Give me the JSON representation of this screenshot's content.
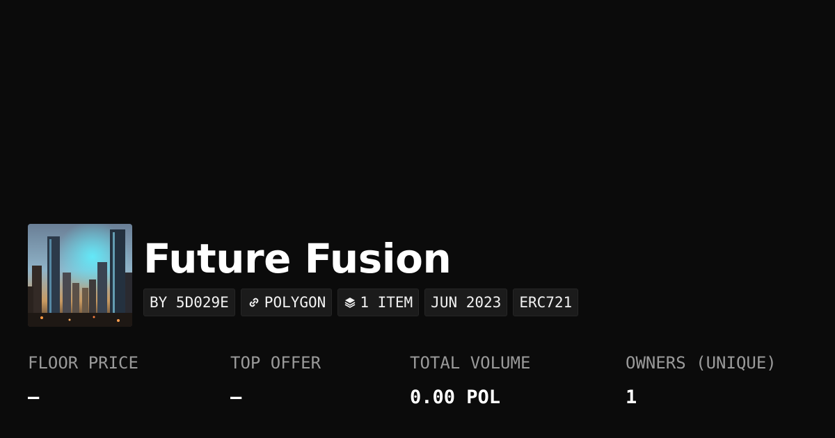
{
  "collection": {
    "title": "Future Fusion",
    "image_alt": "futuristic city skyline artwork",
    "chips": {
      "creator": "BY 5D029E",
      "chain": "POLYGON",
      "chain_icon": "link-icon",
      "items": "1 ITEM",
      "items_icon": "layers-icon",
      "created": "JUN 2023",
      "standard": "ERC721"
    }
  },
  "stats": [
    {
      "label": "FLOOR PRICE",
      "value": "—"
    },
    {
      "label": "TOP OFFER",
      "value": "—"
    },
    {
      "label": "TOTAL VOLUME",
      "value": "0.00 POL"
    },
    {
      "label": "OWNERS (UNIQUE)",
      "value": "1"
    }
  ],
  "colors": {
    "background": "#0b0b0b",
    "chip_background": "#1b1b1b",
    "label_gray": "#9a9a9a",
    "text": "#ffffff"
  }
}
